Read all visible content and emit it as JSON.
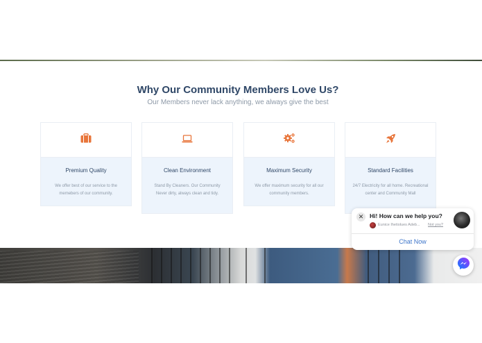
{
  "section": {
    "title": "Why Our Community Members Love Us?",
    "subtitle": "Our Members never lack anything, we always give the best"
  },
  "cards": [
    {
      "title": "Premium Quality",
      "text": "We offer best of our service to the memebers of our community.",
      "icon": "briefcase-icon"
    },
    {
      "title": "Clean Environment",
      "text": "Stand By Cleaners. Our Community Never dirty, always clean and tidy.",
      "icon": "laptop-icon"
    },
    {
      "title": "Maximum Security",
      "text": "We offer maximum security for all our community members.",
      "icon": "gears-icon"
    },
    {
      "title": "Standard Facilities",
      "text": "24/7 Electricity for all home. Recreational center and Community Mall",
      "icon": "rocket-icon"
    }
  ],
  "chat": {
    "greeting": "Hi! How can we help you?",
    "user_name": "Eunice Ihetiolues Adeb...",
    "not_you": "Not you?",
    "cta": "Chat Now",
    "close_symbol": "✕"
  },
  "colors": {
    "accent_orange": "#e8753a",
    "heading": "#2f4767",
    "muted": "#8d99a7",
    "card_bg": "#edf4fc",
    "link_blue": "#3b74c9",
    "messenger_blue": "#1877f2"
  }
}
